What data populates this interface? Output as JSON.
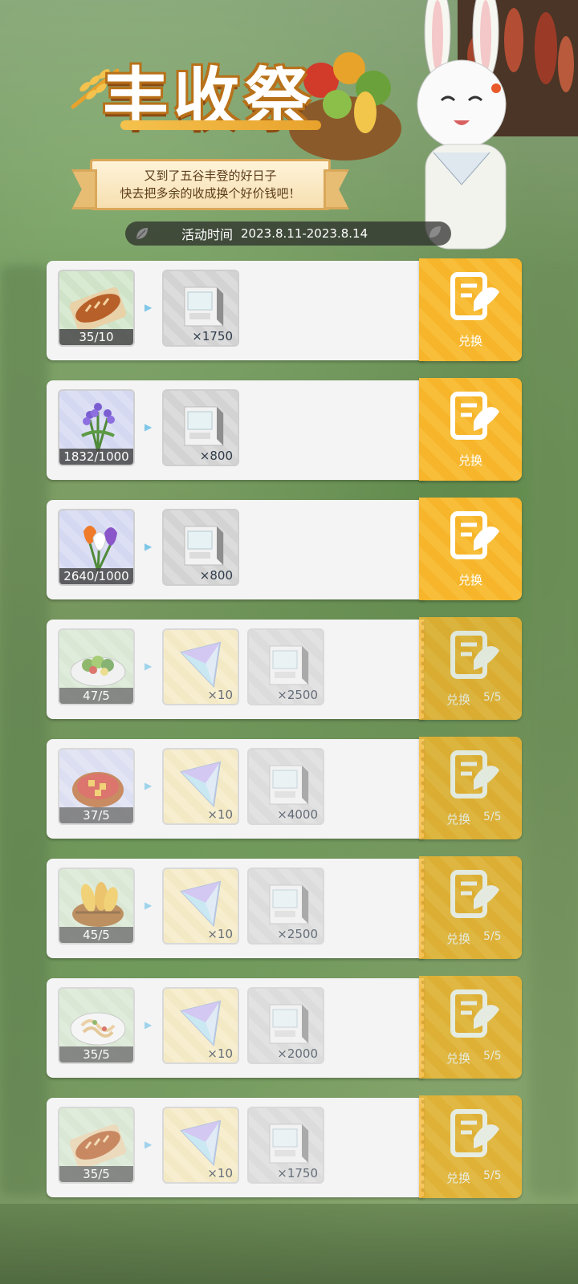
{
  "header": {
    "title": "丰收祭",
    "subtitle_line1": "又到了五谷丰登的好日子",
    "subtitle_line2": "快去把多余的收成换个好价钱吧！",
    "time_label": "活动时间",
    "time_range": "2023.8.11-2023.8.14"
  },
  "colors": {
    "button": "#f6b52a",
    "card": "#f4f4f4",
    "accent_arrow": "#7fc7e8"
  },
  "exchange_button_label": "兑换",
  "rows": [
    {
      "item": "bread",
      "count": "35/10",
      "rewards": [
        {
          "type": "ticket",
          "qty": "×1750"
        }
      ],
      "progress": ""
    },
    {
      "item": "lavender",
      "count": "1832/1000",
      "rewards": [
        {
          "type": "ticket",
          "qty": "×800"
        }
      ],
      "progress": ""
    },
    {
      "item": "tulips",
      "count": "2640/1000",
      "rewards": [
        {
          "type": "ticket",
          "qty": "×800"
        }
      ],
      "progress": ""
    },
    {
      "item": "salad",
      "count": "47/5",
      "rewards": [
        {
          "type": "crystal",
          "qty": "×10"
        },
        {
          "type": "ticket",
          "qty": "×2500"
        }
      ],
      "progress": "5/5"
    },
    {
      "item": "stew",
      "count": "37/5",
      "rewards": [
        {
          "type": "crystal",
          "qty": "×10"
        },
        {
          "type": "ticket",
          "qty": "×4000"
        }
      ],
      "progress": "5/5"
    },
    {
      "item": "corn-basket",
      "count": "45/5",
      "rewards": [
        {
          "type": "crystal",
          "qty": "×10"
        },
        {
          "type": "ticket",
          "qty": "×2500"
        }
      ],
      "progress": "5/5"
    },
    {
      "item": "pasta",
      "count": "35/5",
      "rewards": [
        {
          "type": "crystal",
          "qty": "×10"
        },
        {
          "type": "ticket",
          "qty": "×2000"
        }
      ],
      "progress": "5/5"
    },
    {
      "item": "bread",
      "count": "35/5",
      "rewards": [
        {
          "type": "crystal",
          "qty": "×10"
        },
        {
          "type": "ticket",
          "qty": "×1750"
        }
      ],
      "progress": "5/5"
    }
  ]
}
